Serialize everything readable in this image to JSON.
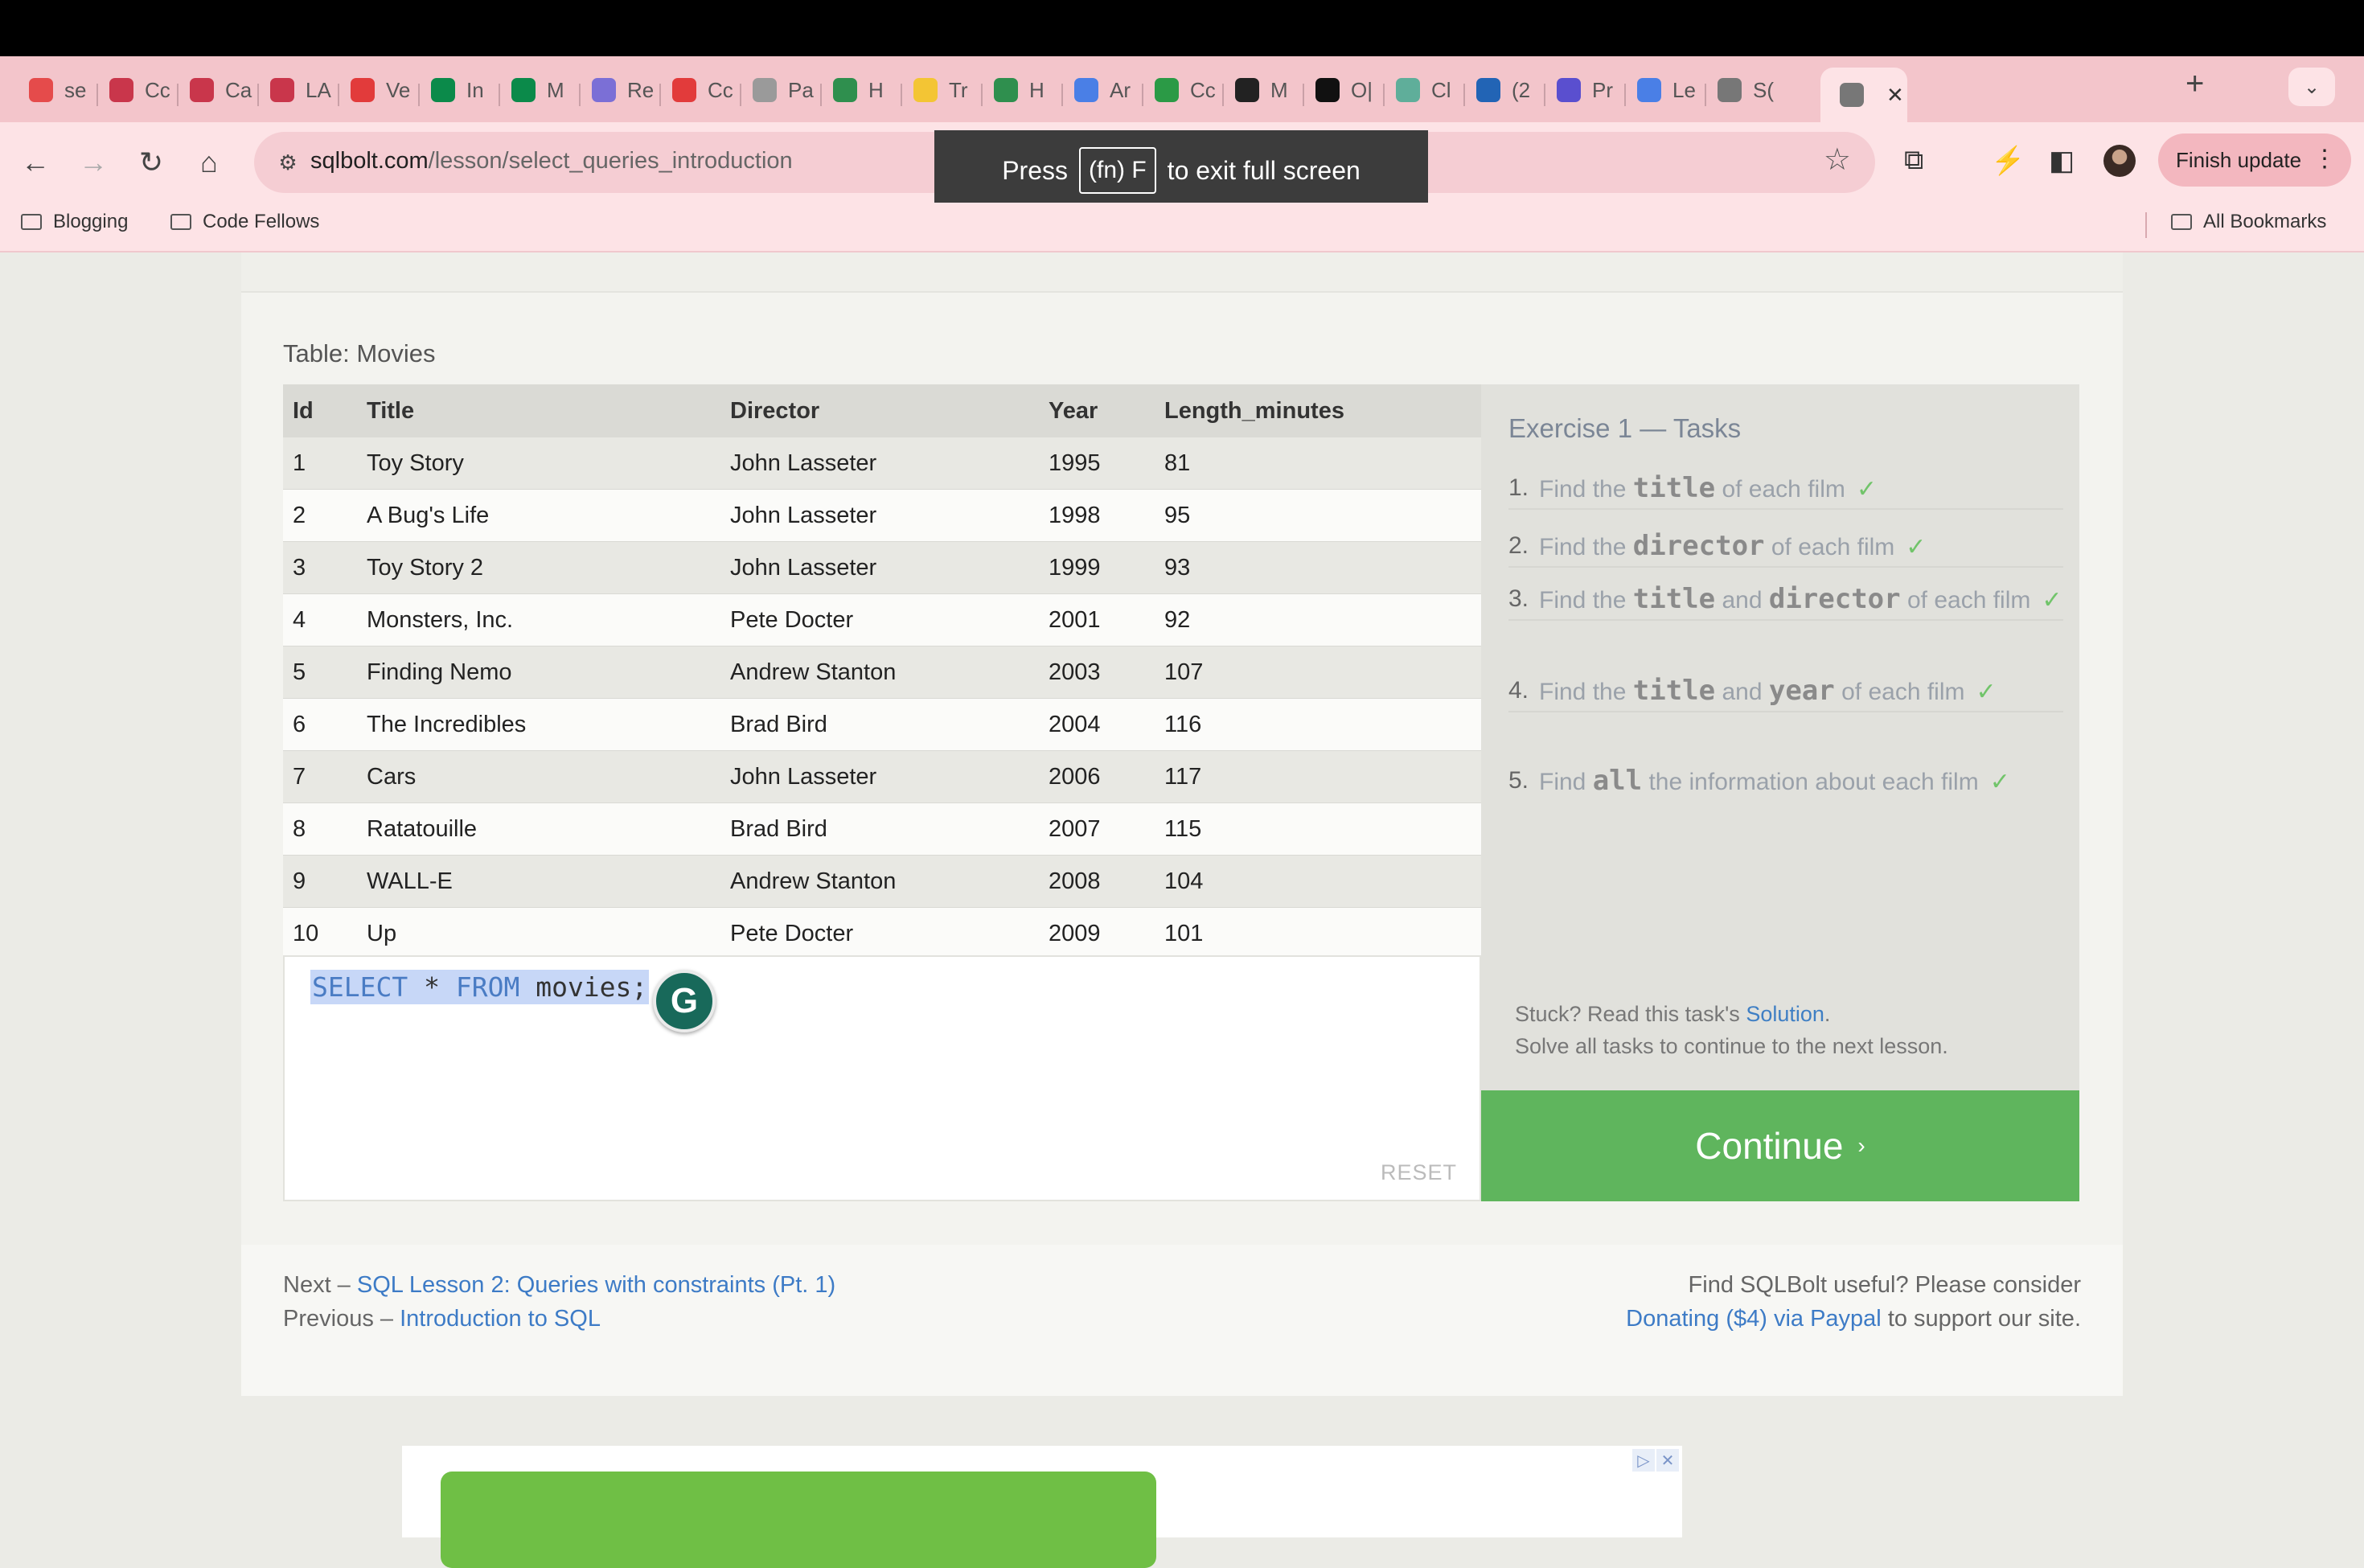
{
  "browser": {
    "tabs": [
      {
        "label": "se",
        "color": "#e54b4b"
      },
      {
        "label": "Cc",
        "color": "#c9364b"
      },
      {
        "label": "Ca",
        "color": "#c9364b"
      },
      {
        "label": "LA",
        "color": "#c9364b"
      },
      {
        "label": "Ve",
        "color": "#e23b3b"
      },
      {
        "label": "In",
        "color": "#0b8a4a"
      },
      {
        "label": "M",
        "color": "#0b8a4a"
      },
      {
        "label": "Re",
        "color": "#7b6fd6"
      },
      {
        "label": "Cc",
        "color": "#e23b3b"
      },
      {
        "label": "Pa",
        "color": "#9a9a9a"
      },
      {
        "label": "H",
        "color": "#2f8f4e"
      },
      {
        "label": "Tr",
        "color": "#f3c534"
      },
      {
        "label": "H",
        "color": "#2f8f4e"
      },
      {
        "label": "Ar",
        "color": "#4a7fe6"
      },
      {
        "label": "Cc",
        "color": "#2b9a46"
      },
      {
        "label": "M",
        "color": "#222222"
      },
      {
        "label": "O|",
        "color": "#111111"
      },
      {
        "label": "Cl",
        "color": "#5fae9a"
      },
      {
        "label": "(2",
        "color": "#2264b5"
      },
      {
        "label": "Pr",
        "color": "#5a4fcf"
      },
      {
        "label": "Le",
        "color": "#4a7fe6"
      },
      {
        "label": "S(",
        "color": "#777777"
      },
      {
        "label": "",
        "color": "#777777",
        "active": true
      }
    ],
    "new_tab": "+",
    "url_domain": "sqlbolt.com",
    "url_path": "/lesson/select_queries_introduction",
    "finish_update": "Finish update",
    "fullscreen_banner": {
      "before": "Press",
      "key": "(fn) F",
      "after": "to exit full screen"
    },
    "bookmarks": [
      "Blogging",
      "Code Fellows"
    ],
    "all_bookmarks": "All Bookmarks"
  },
  "lesson": {
    "table_caption": "Table: Movies",
    "columns": [
      "Id",
      "Title",
      "Director",
      "Year",
      "Length_minutes"
    ],
    "rows": [
      [
        "1",
        "Toy Story",
        "John Lasseter",
        "1995",
        "81"
      ],
      [
        "2",
        "A Bug's Life",
        "John Lasseter",
        "1998",
        "95"
      ],
      [
        "3",
        "Toy Story 2",
        "John Lasseter",
        "1999",
        "93"
      ],
      [
        "4",
        "Monsters, Inc.",
        "Pete Docter",
        "2001",
        "92"
      ],
      [
        "5",
        "Finding Nemo",
        "Andrew Stanton",
        "2003",
        "107"
      ],
      [
        "6",
        "The Incredibles",
        "Brad Bird",
        "2004",
        "116"
      ],
      [
        "7",
        "Cars",
        "John Lasseter",
        "2006",
        "117"
      ],
      [
        "8",
        "Ratatouille",
        "Brad Bird",
        "2007",
        "115"
      ],
      [
        "9",
        "WALL-E",
        "Andrew Stanton",
        "2008",
        "104"
      ],
      [
        "10",
        "Up",
        "Pete Docter",
        "2009",
        "101"
      ]
    ],
    "editor": {
      "code_kw1": "SELECT",
      "code_star": "*",
      "code_kw2": "FROM",
      "code_rest": "movies;",
      "reset": "RESET",
      "grammarly": "G"
    },
    "tasks": {
      "heading_prefix": "Exercise 1 —",
      "heading_suffix": "Tasks",
      "items": [
        {
          "num": "1.",
          "pre": "Find the",
          "c1": "title",
          "mid": "",
          "c2": "",
          "post": "of each film",
          "check": "✓"
        },
        {
          "num": "2.",
          "pre": "Find the",
          "c1": "director",
          "mid": "",
          "c2": "",
          "post": "of each film",
          "check": "✓"
        },
        {
          "num": "3.",
          "pre": "Find the",
          "c1": "title",
          "mid": "and",
          "c2": "director",
          "post": "of each film",
          "check": "✓"
        },
        {
          "num": "4.",
          "pre": "Find the",
          "c1": "title",
          "mid": "and",
          "c2": "year",
          "post": "of each film",
          "check": "✓"
        },
        {
          "num": "5.",
          "pre": "Find",
          "c1": "all",
          "mid": "",
          "c2": "",
          "post": "the information about each film",
          "check": "✓"
        }
      ],
      "stuck_prefix": "Stuck? Read this task's",
      "stuck_link": "Solution",
      "stuck_suffix": ".",
      "solve_all": "Solve all tasks to continue to the next lesson.",
      "continue_label": "Continue",
      "continue_chev": "›"
    },
    "footer_nav": {
      "next_prefix": "Next –",
      "next_link": "SQL Lesson 2: Queries with constraints (Pt. 1)",
      "prev_prefix": "Previous –",
      "prev_link": "Introduction to SQL",
      "donate_line1": "Find SQLBolt useful? Please consider",
      "donate_link": "Donating ($4) via Paypal",
      "donate_suffix": "to support our site."
    }
  }
}
